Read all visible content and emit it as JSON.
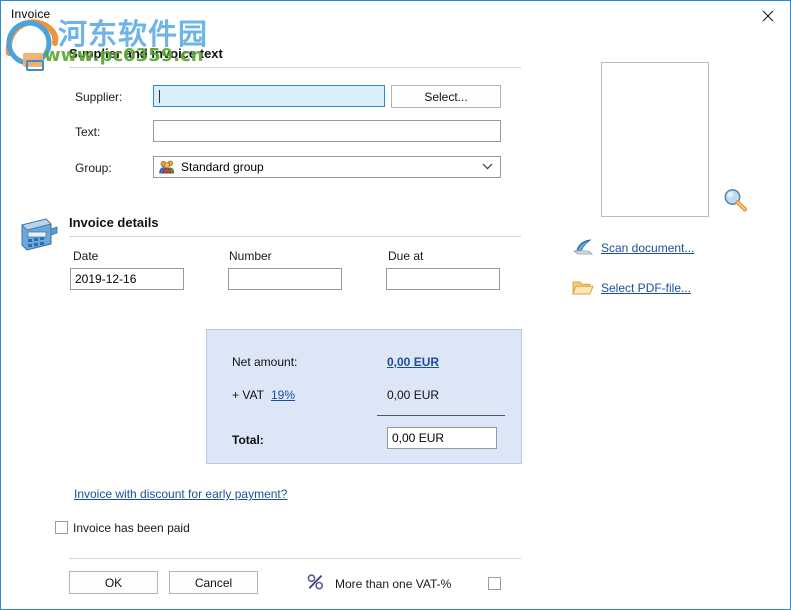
{
  "window": {
    "title": "Invoice",
    "close_icon": "close-icon",
    "border_color": "#2a8ad4"
  },
  "watermark": {
    "chinese_text": "河东软件园",
    "url_text": "www.pc0359.cn",
    "logo_icon": "site-logo-icon",
    "chinese_color": "#6db4e8",
    "url_color": "#5aa832"
  },
  "supplier_section": {
    "title": "Supplier and invoice text",
    "supplier": {
      "label": "Supplier:",
      "value": "",
      "placeholder": ""
    },
    "select_button": "Select...",
    "text": {
      "label": "Text:",
      "value": "",
      "placeholder": ""
    },
    "group": {
      "label": "Group:",
      "selected": "Standard group",
      "icon": "users-group-icon",
      "chevron_icon": "chevron-down-icon",
      "options": [
        "Standard group"
      ]
    }
  },
  "invoice_details": {
    "title": "Invoice details",
    "icon": "cash-register-icon",
    "date": {
      "label": "Date",
      "value": "2019-12-16"
    },
    "number": {
      "label": "Number",
      "value": ""
    },
    "due_at": {
      "label": "Due at",
      "value": ""
    }
  },
  "amounts": {
    "net_label": "Net amount:",
    "net_value": "0,00 EUR",
    "vat_label": "+ VAT",
    "vat_rate": "19%",
    "vat_value": "0,00 EUR",
    "total_label": "Total:",
    "total_value": "0,00 EUR",
    "panel_color": "#dde6f7",
    "link_color": "#1b4f9c"
  },
  "options": {
    "discount_link": "Invoice with discount for early payment?",
    "paid_checkbox_label": "Invoice has been paid",
    "paid_checked": false
  },
  "footer": {
    "ok_label": "OK",
    "cancel_label": "Cancel",
    "vat_icon": "percent-icon",
    "multi_vat_label": "More than one VAT-%",
    "multi_vat_checked": false
  },
  "document_panel": {
    "preview_placeholder": "",
    "magnifier_icon": "magnifier-icon",
    "scan_icon": "scanner-icon",
    "scan_label": "Scan document...",
    "pdf_icon": "folder-open-icon",
    "pdf_label": "Select PDF-file..."
  }
}
